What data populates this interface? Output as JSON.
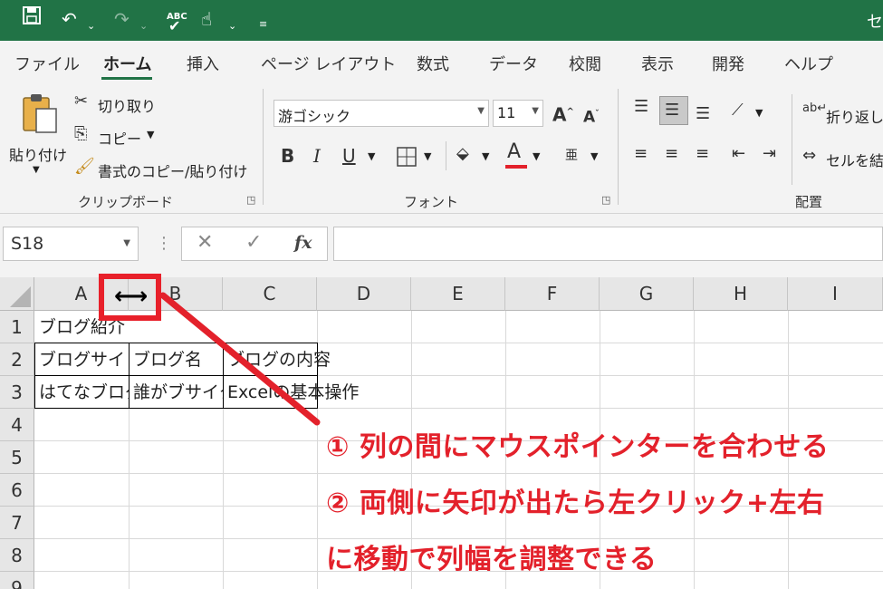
{
  "titlebar": {
    "title_partial": "セ",
    "save_icon": "save-icon",
    "undo_icon": "undo-icon",
    "redo_icon": "redo-icon",
    "spellcheck_label": "ABC",
    "touch_icon": "touch-mode-icon",
    "customize_icon": "customize-qat-icon",
    "bg_color": "#217346"
  },
  "tabs": [
    {
      "label": "ファイル"
    },
    {
      "label": "ホーム",
      "active": true
    },
    {
      "label": "挿入"
    },
    {
      "label": "ページ レイアウト"
    },
    {
      "label": "数式"
    },
    {
      "label": "データ"
    },
    {
      "label": "校閲"
    },
    {
      "label": "表示"
    },
    {
      "label": "開発"
    },
    {
      "label": "ヘルプ"
    }
  ],
  "clipboard": {
    "paste_label": "貼り付け",
    "cut_label": "切り取り",
    "copy_label": "コピー",
    "format_painter_label": "書式のコピー/貼り付け",
    "group_label": "クリップボード"
  },
  "font": {
    "font_name": "游ゴシック",
    "font_size": "11",
    "bold": "B",
    "italic": "I",
    "underline": "U",
    "font_color_letter": "A",
    "phonetic_letter": "亜",
    "group_label": "フォント",
    "font_color_bar": "#e3212b"
  },
  "alignment": {
    "wrap_text_label": "折り返し",
    "merge_label": "セルを結",
    "group_label": "配置"
  },
  "formula_bar": {
    "name_box": "S18",
    "fx_label": "fx",
    "formula_value": ""
  },
  "grid": {
    "columns": [
      "A",
      "B",
      "C",
      "D",
      "E",
      "F",
      "G",
      "H",
      "I"
    ],
    "rows": [
      "1",
      "2",
      "3",
      "4",
      "5",
      "6",
      "7",
      "8",
      "9"
    ],
    "cells": {
      "A1": "ブログ紹介",
      "A2": "ブログサイト",
      "B2": "ブログ名",
      "C2": "ブログの内容",
      "A3": "はてなブログ",
      "B3": "誰がブサイクや",
      "C3": "Excelの基本操作"
    }
  },
  "annotation": {
    "line1": "① 列の間にマウスポインターを合わせる",
    "line2": "② 両側に矢印が出たら左クリック+左右",
    "line3": "に移動で列幅を調整できる",
    "cursor_icon": "column-resize-cursor-icon",
    "color": "#e3212b"
  }
}
